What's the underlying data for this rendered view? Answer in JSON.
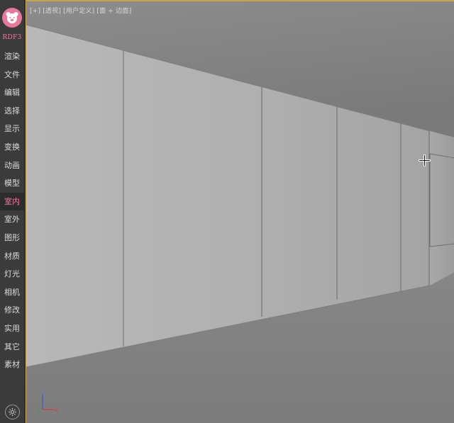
{
  "sidebar": {
    "brand": "RDF3",
    "items": [
      {
        "label": "渲染",
        "name": "render"
      },
      {
        "label": "文件",
        "name": "file"
      },
      {
        "label": "编辑",
        "name": "edit"
      },
      {
        "label": "选择",
        "name": "select"
      },
      {
        "label": "显示",
        "name": "display"
      },
      {
        "label": "变换",
        "name": "transform"
      },
      {
        "label": "动画",
        "name": "animation"
      },
      {
        "label": "模型",
        "name": "model"
      },
      {
        "label": "室内",
        "name": "interior",
        "active": true
      },
      {
        "label": "室外",
        "name": "exterior"
      },
      {
        "label": "图形",
        "name": "shapes"
      },
      {
        "label": "材质",
        "name": "material"
      },
      {
        "label": "灯光",
        "name": "lights"
      },
      {
        "label": "相机",
        "name": "camera"
      },
      {
        "label": "修改",
        "name": "modify"
      },
      {
        "label": "实用",
        "name": "utilities"
      },
      {
        "label": "其它",
        "name": "other"
      },
      {
        "label": "素材",
        "name": "assets"
      }
    ],
    "settings_icon": "gear-icon",
    "logo_icon": "bear-face-icon"
  },
  "viewport": {
    "label": "[+] [透视] [用户定义] [面 + 边面]",
    "accent": "#c9a34a",
    "cursor_icon": "move-crosshair-icon",
    "axis": {
      "z": "z",
      "y": "y",
      "x": "x"
    }
  },
  "colors": {
    "brand_pink": "#e8789a",
    "active_text": "#f07aa0",
    "axis_x": "#d23a3a",
    "axis_y": "#3aa04a",
    "axis_z": "#3a5ad2"
  }
}
